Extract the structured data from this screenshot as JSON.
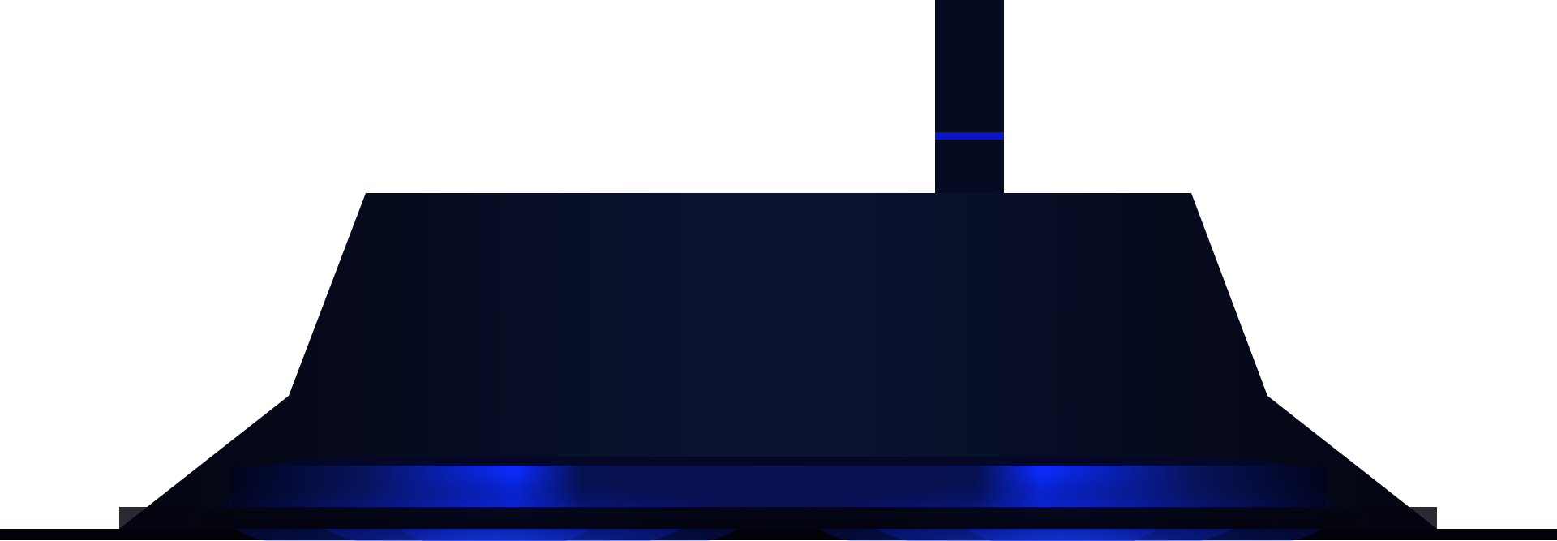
{
  "colors": {
    "background": "#ffffff",
    "body_dark": "#03050f",
    "body_mid": "#0a1230",
    "glow_blue": "#0a2bff",
    "glow_deep": "#06114f",
    "antenna_stripe": "#0a14c8",
    "base_line": "#02030a"
  },
  "icons": {
    "device": "router-hood-silhouette",
    "antenna": "antenna-mast",
    "light": "underglow-light-strip"
  }
}
